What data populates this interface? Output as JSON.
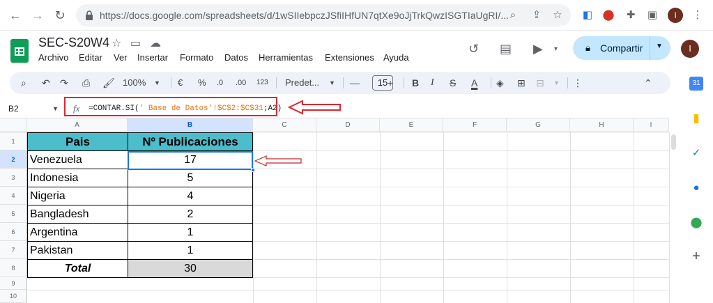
{
  "browser": {
    "url": "https://docs.google.com/spreadsheets/d/1wSIIebpczJSfiIHfUN7qtXe9oJjTrkQwzISGTIaUgRI/...",
    "profile_initial": "I"
  },
  "app": {
    "title": "SEC-S20W4",
    "menu": [
      "Archivo",
      "Editar",
      "Ver",
      "Insertar",
      "Formato",
      "Datos",
      "Herramientas",
      "Extensiones",
      "Ayuda"
    ],
    "share_label": "Compartir",
    "profile_initial": "I"
  },
  "toolbar": {
    "zoom": "100%",
    "currency": "€",
    "percent": "%",
    "dec_less": ".0",
    "dec_more": ".00",
    "number_format": "123",
    "font": "Predet...",
    "font_size": "15"
  },
  "formula_bar": {
    "cell_ref": "B2",
    "formula_prefix": "=CONTAR.SI(",
    "formula_string": "' Base de Datos'!$C$2:$C$31",
    "formula_suffix": ";A2)"
  },
  "grid": {
    "columns": [
      "A",
      "B",
      "C",
      "D",
      "E",
      "F",
      "G",
      "H",
      "I"
    ],
    "rows": [
      "1",
      "2",
      "3",
      "4",
      "5",
      "6",
      "7",
      "8",
      "9",
      "10"
    ],
    "header": {
      "a": "Pais",
      "b": "Nº Publicaciones"
    },
    "data": [
      {
        "country": "Venezuela",
        "count": "17"
      },
      {
        "country": "Indonesia",
        "count": "5"
      },
      {
        "country": "Nigeria",
        "count": "4"
      },
      {
        "country": "Bangladesh",
        "count": "2"
      },
      {
        "country": "Argentina",
        "count": "1"
      },
      {
        "country": "Pakistan",
        "count": "1"
      }
    ],
    "total_label": "Total",
    "total_value": "30"
  },
  "colors": {
    "header_fill": "#4bbdcb",
    "total_fill": "#d9d9d9",
    "annotation": "#e0252f",
    "selection": "#1a73e8"
  }
}
